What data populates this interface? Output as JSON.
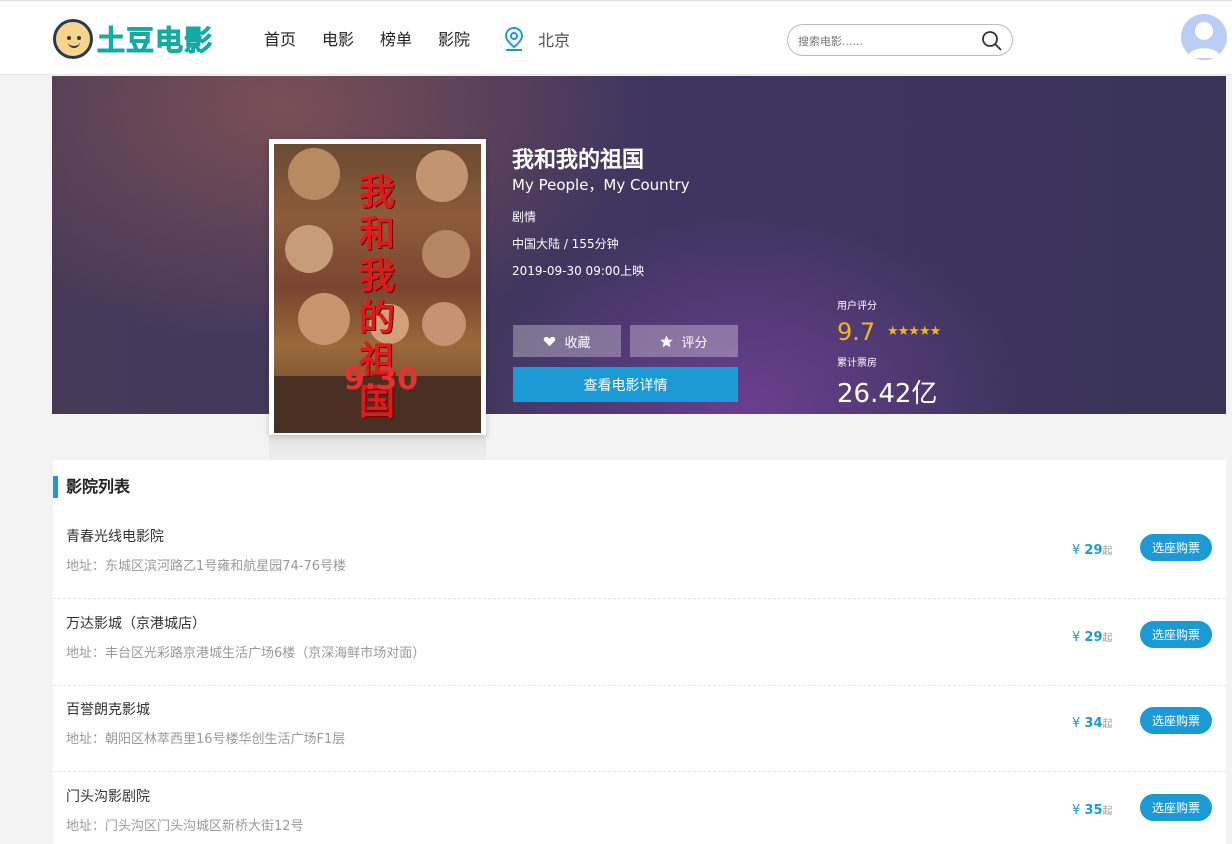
{
  "header": {
    "logo_text": "土豆电影",
    "nav": [
      "首页",
      "电影",
      "榜单",
      "影院"
    ],
    "city": "北京",
    "search_placeholder": "搜索电影......"
  },
  "movie": {
    "title": "我和我的祖国",
    "title_en": "My People，My Country",
    "genre": "剧情",
    "region_duration": "中国大陆 / 155分钟",
    "release": "2019-09-30 09:00上映",
    "poster_title": "我和我的祖国",
    "poster_date": "9.30",
    "fav_label": "收藏",
    "rate_label": "评分",
    "detail_label": "查看电影详情",
    "score_label": "用户评分",
    "score": "9.7",
    "stars": "★★★★★",
    "box_label": "累计票房",
    "box_office": "26.42亿"
  },
  "cinemas": {
    "heading": "影院列表",
    "buy_label": "选座购票",
    "currency": "¥",
    "from_label": "起",
    "items": [
      {
        "name": "青春光线电影院",
        "address": "地址：东城区滨河路乙1号雍和航星园74-76号楼",
        "price": "29"
      },
      {
        "name": "万达影城（京港城店）",
        "address": "地址：丰台区光彩路京港城生活广场6楼（京深海鲜市场对面）",
        "price": "29"
      },
      {
        "name": "百誉朗克影城",
        "address": "地址：朝阳区林萃西里16号楼华创生活广场F1层",
        "price": "34"
      },
      {
        "name": "门头沟影剧院",
        "address": "地址：门头沟区门头沟城区新桥大街12号",
        "price": "35"
      }
    ]
  },
  "colors": {
    "accent": "#1b9ad6",
    "score": "#f6b41b",
    "logo": "#1fc7c0"
  }
}
